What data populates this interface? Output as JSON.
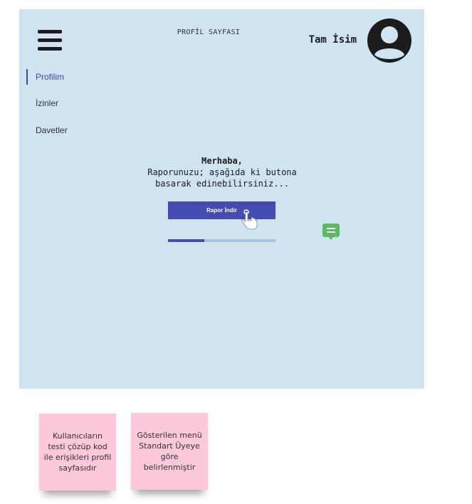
{
  "header": {
    "title": "PROFİL SAYFASI",
    "user_name": "Tam İsim",
    "avatar_icon": "user-circle-icon",
    "menu_icon": "hamburger-menu-icon"
  },
  "sidebar": {
    "items": [
      {
        "label": "Profilim",
        "active": true
      },
      {
        "label": "İzinler",
        "active": false
      },
      {
        "label": "Davetler",
        "active": false
      }
    ]
  },
  "main": {
    "greeting": "Merhaba,",
    "message_line1": "Raporunuzu; aşağıda ki butona",
    "message_line2": "basarak edinebilirsiniz...",
    "download_button_label": "Rapor İndir",
    "download_progress": 0.34,
    "chat_icon": "chat-bubble-icon",
    "pointer_icon": "hand-pointer-icon"
  },
  "annotations": [
    {
      "text": "Kullanıcıların testi çözüp kod ile erişikleri profil sayfasıdır"
    },
    {
      "text": "Gösterilen menü Standart Üyeye göre belirlenmiştir"
    }
  ],
  "colors": {
    "background": "#cfe3f1",
    "accent": "#434caf",
    "progress_track": "#a9c2e0",
    "chat": "#5cb85c",
    "note": "#fcc8da"
  }
}
